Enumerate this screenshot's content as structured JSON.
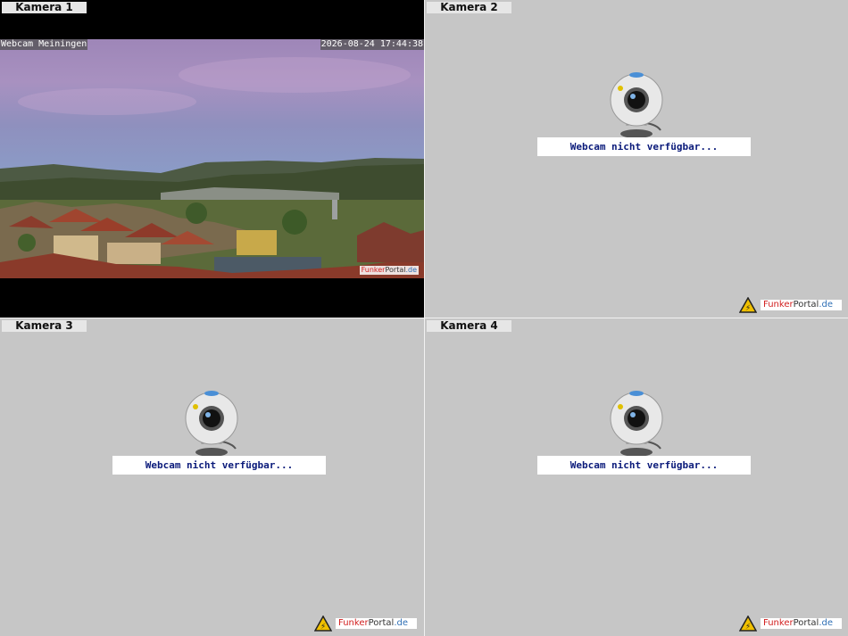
{
  "cameras": [
    {
      "label": "Kamera 1",
      "available": true,
      "overlay_left": "Webcam Meiningen",
      "overlay_right": "2026-08-24 17:44:38",
      "watermark": {
        "part1": "Funker",
        "part2": "Portal",
        "part3": ".de"
      }
    },
    {
      "label": "Kamera 2",
      "available": false,
      "message": "Webcam nicht verfügbar...",
      "logo": {
        "part1": "Funker",
        "part2": "Portal",
        "part3": ".de"
      }
    },
    {
      "label": "Kamera 3",
      "available": false,
      "message": "Webcam nicht verfügbar...",
      "logo": {
        "part1": "Funker",
        "part2": "Portal",
        "part3": ".de"
      }
    },
    {
      "label": "Kamera 4",
      "available": false,
      "message": "Webcam nicht verfügbar...",
      "logo": {
        "part1": "Funker",
        "part2": "Portal",
        "part3": ".de"
      }
    }
  ],
  "colors": {
    "background": "#c6c6c6",
    "message_text": "#0a1a7a",
    "logo_red": "#d21f1f",
    "logo_blue": "#2f6fb5"
  },
  "icons": {
    "placeholder": "webcam-icon",
    "logo": "warning-triangle-icon"
  }
}
